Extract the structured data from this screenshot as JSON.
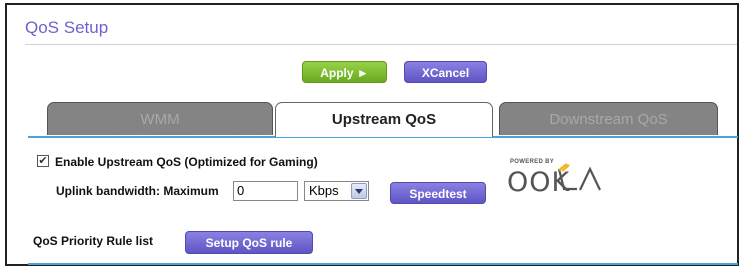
{
  "page": {
    "title": "QoS Setup"
  },
  "actions": {
    "apply_label": "Apply ►",
    "cancel_label": "XCancel"
  },
  "tabs": [
    {
      "label": "WMM",
      "active": false
    },
    {
      "label": "Upstream QoS",
      "active": true
    },
    {
      "label": "Downstream QoS",
      "active": false
    }
  ],
  "upstream": {
    "enable_label": "Enable Upstream QoS (Optimized for Gaming)",
    "enabled": true,
    "bandwidth_label": "Uplink bandwidth: Maximum",
    "bandwidth_value": "0",
    "unit_selected": "Kbps",
    "speedtest_label": "Speedtest",
    "powered_by": "POWERED BY",
    "brand_logo": "OOKLA"
  },
  "rules": {
    "list_label": "QoS Priority Rule list",
    "setup_button": "Setup QoS rule"
  },
  "colors": {
    "title": "#6b63c9",
    "apply": "#7bbd2a",
    "purple": "#6a60d0",
    "divider": "#4aa3d9"
  }
}
